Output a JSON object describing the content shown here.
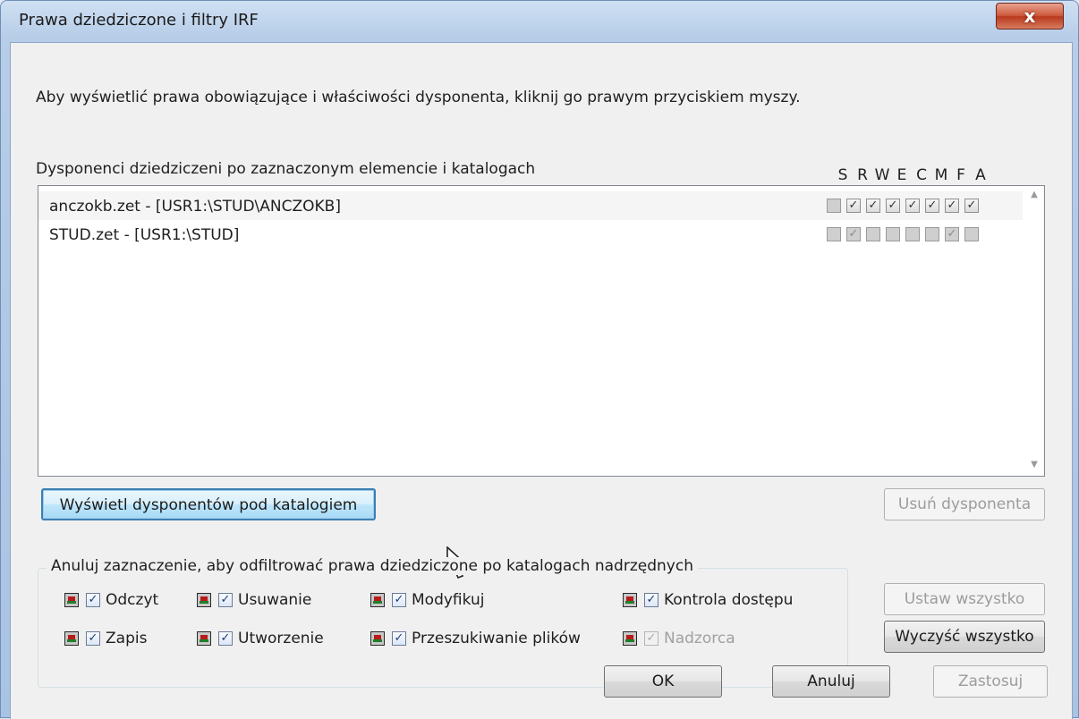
{
  "window": {
    "title": "Prawa dziedziczone i filtry IRF",
    "close_glyph": "x"
  },
  "instructions": "Aby wyświetlić prawa obowiązujące i właściwości dysponenta, kliknij go prawym przyciskiem myszy.",
  "list": {
    "label": "Dysponenci dziedziczeni po zaznaczonym elemencie i katalogach",
    "columns": [
      "S",
      "R",
      "W",
      "E",
      "C",
      "M",
      "F",
      "A"
    ],
    "rows": [
      {
        "text": "anczokb.zet - [USR1:\\STUD\\ANCZOKB]",
        "rights": [
          false,
          true,
          true,
          true,
          true,
          true,
          true,
          true
        ],
        "grayed": [
          true,
          false,
          false,
          false,
          false,
          false,
          false,
          false
        ]
      },
      {
        "text": "STUD.zet - [USR1:\\STUD]",
        "rights": [
          false,
          true,
          false,
          false,
          false,
          false,
          true,
          false
        ],
        "grayed": [
          true,
          true,
          true,
          true,
          true,
          true,
          true,
          true
        ]
      }
    ]
  },
  "buttons": {
    "show_trustees": "Wyświetl dysponentów pod katalogiem",
    "remove_trustee": "Usuń dysponenta",
    "set_all": "Ustaw wszystko",
    "clear_all": "Wyczyść wszystko",
    "ok": "OK",
    "cancel": "Anuluj",
    "apply": "Zastosuj"
  },
  "filter_group": {
    "title": "Anuluj zaznaczenie, aby odfiltrować prawa dziedziczone po katalogach nadrzędnych",
    "items": [
      {
        "label": "Odczyt",
        "checked": true,
        "enabled": true
      },
      {
        "label": "Usuwanie",
        "checked": true,
        "enabled": true
      },
      {
        "label": "Modyfikuj",
        "checked": true,
        "enabled": true
      },
      {
        "label": "Kontrola dostępu",
        "checked": true,
        "enabled": true
      },
      {
        "label": "Zapis",
        "checked": true,
        "enabled": true
      },
      {
        "label": "Utworzenie",
        "checked": true,
        "enabled": true
      },
      {
        "label": "Przeszukiwanie plików",
        "checked": true,
        "enabled": true
      },
      {
        "label": "Nadzorca",
        "checked": true,
        "enabled": false
      }
    ]
  },
  "icons": {
    "filter": "irf-filter-icon",
    "check": "✓",
    "scroll_up": "▲",
    "scroll_down": "▼"
  }
}
